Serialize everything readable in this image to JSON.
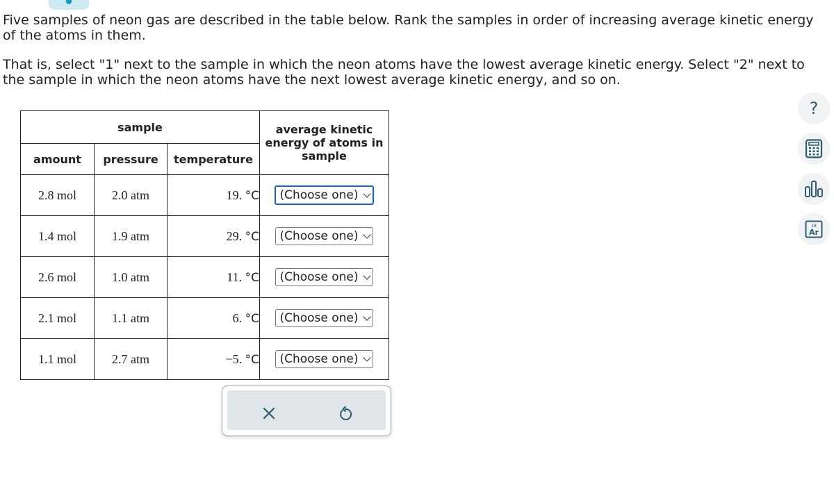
{
  "prompt": {
    "paragraph1": "Five samples of neon gas are described in the table below. Rank the samples in order of increasing average kinetic energy of the atoms in them.",
    "paragraph2": "That is, select \"1\" next to the sample in which the neon atoms have the lowest average kinetic energy. Select \"2\" next to the sample in which the neon atoms have the next lowest average kinetic energy, and so on."
  },
  "table": {
    "group_header": "sample",
    "headers": {
      "amount": "amount",
      "pressure": "pressure",
      "temperature": "temperature",
      "ake": "average kinetic energy of atoms in sample"
    },
    "rows": [
      {
        "amount": "2.8 mol",
        "pressure": "2.0 atm",
        "temp_value": "19.",
        "temp_unit": "°C",
        "selection": "(Choose one)"
      },
      {
        "amount": "1.4 mol",
        "pressure": "1.9 atm",
        "temp_value": "29.",
        "temp_unit": "°C",
        "selection": "(Choose one)"
      },
      {
        "amount": "2.6 mol",
        "pressure": "1.0 atm",
        "temp_value": "11.",
        "temp_unit": "°C",
        "selection": "(Choose one)"
      },
      {
        "amount": "2.1 mol",
        "pressure": "1.1 atm",
        "temp_value": "6.",
        "temp_unit": "°C",
        "selection": "(Choose one)"
      },
      {
        "amount": "1.1 mol",
        "pressure": "2.7 atm",
        "temp_value": "−5.",
        "temp_unit": "°C",
        "selection": "(Choose one)"
      }
    ]
  },
  "actions": {
    "clear_icon": "close-icon",
    "reset_icon": "undo-icon"
  },
  "side_tools": [
    {
      "name": "help",
      "icon": "question-icon",
      "glyph": "?"
    },
    {
      "name": "calculator",
      "icon": "calculator-icon"
    },
    {
      "name": "data",
      "icon": "bar-chart-icon"
    },
    {
      "name": "periodic-table",
      "icon": "periodic-table-icon",
      "number": "18",
      "symbol": "Ar"
    }
  ],
  "colors": {
    "accent": "#1a5fc8",
    "icon": "#2f5b6e",
    "toolbar_bg": "#dfe5e8"
  }
}
